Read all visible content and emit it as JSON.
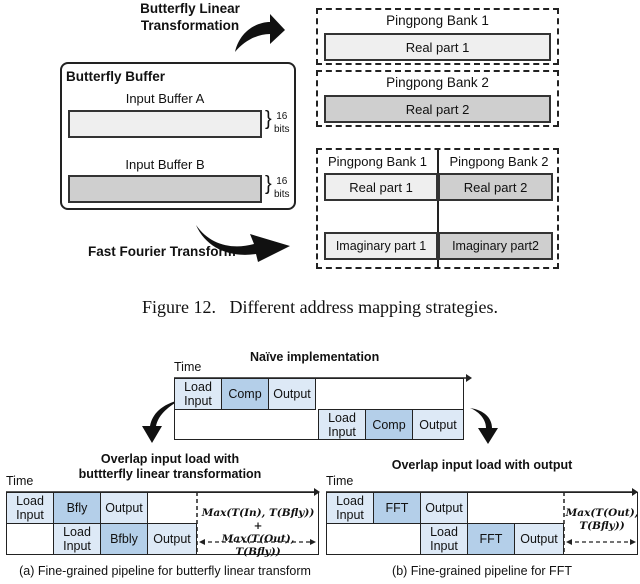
{
  "top_figure": {
    "bfly_label_line1": "Butterfly Linear",
    "bfly_label_line2": "Transformation",
    "fft_label": "Fast Fourier Transform",
    "buffer": {
      "title": "Butterfly  Buffer",
      "input_a": "Input  Buffer A",
      "input_b": "Input  Buffer B",
      "width_num": "16",
      "width_unit": "bits"
    },
    "bfly_banks": [
      {
        "title": "Pingpong Bank 1",
        "cell": "Real part 1"
      },
      {
        "title": "Pingpong Bank 2",
        "cell": "Real part 2"
      }
    ],
    "fft_banks": {
      "bank1_title": "Pingpong Bank 1",
      "bank2_title": "Pingpong Bank 2",
      "real1": "Real part 1",
      "real2": "Real part 2",
      "imag1": "Imaginary part 1",
      "imag2": "Imaginary part2"
    },
    "caption": "Figure 12.   Different address mapping strategies."
  },
  "bottom_figure": {
    "naive": {
      "title": "Naïve implementation",
      "time": "Time",
      "row1": [
        "Load\nInput",
        "Comp",
        "Output"
      ],
      "row2": [
        "Load\nInput",
        "Comp",
        "Output"
      ]
    },
    "left": {
      "title_line1": "Overlap input load with",
      "title_line2": "buttterfly linear transformation",
      "time": "Time",
      "row1": [
        "Load\nInput",
        "Bfly",
        "Output"
      ],
      "row2": [
        "Load\nInput",
        "Bfbly",
        "Output"
      ],
      "formula_line1": "Max(T(In), T(Bfly)) +",
      "formula_line2": "Max(T(Out), T(Bfly))",
      "caption": "(a) Fine-grained pipeline for butterfly linear transform"
    },
    "right": {
      "title": "Overlap input load with output",
      "time": "Time",
      "row1": [
        "Load\nInput",
        "FFT",
        "Output"
      ],
      "row2": [
        "Load\nInput",
        "FFT",
        "Output"
      ],
      "formula_line1": "Max(T(Out),",
      "formula_line2": "T(Bfly))",
      "caption": "(b) Fine-grained pipeline for FFT"
    }
  },
  "colors": {
    "light_gray": "#efefef",
    "dark_gray": "#cfcfcf",
    "load_blue": "#dde9f6",
    "comp_blue": "#b4cfe9"
  }
}
